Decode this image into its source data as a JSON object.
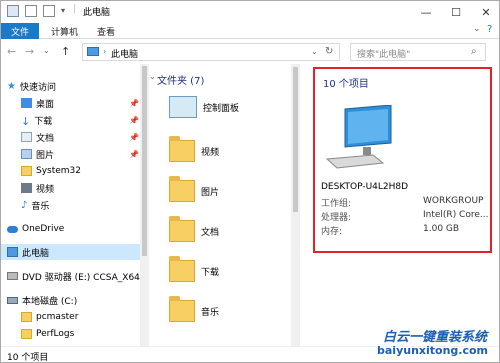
{
  "window": {
    "title": "此电脑"
  },
  "ribbon": {
    "tabs": [
      "文件",
      "计算机",
      "查看"
    ]
  },
  "nav": {
    "address": "此电脑",
    "search_placeholder": "搜索\"此电脑\"",
    "back": "←",
    "forward": "→",
    "up": "↑"
  },
  "sidebar": {
    "items": [
      {
        "label": "快速访问"
      },
      {
        "label": "桌面"
      },
      {
        "label": "下载"
      },
      {
        "label": "文档"
      },
      {
        "label": "图片"
      },
      {
        "label": "System32"
      },
      {
        "label": "视频"
      },
      {
        "label": "音乐"
      },
      {
        "label": "OneDrive"
      },
      {
        "label": "此电脑"
      },
      {
        "label": "DVD 驱动器 (E:) CCSA_X64"
      },
      {
        "label": "本地磁盘 (C:)"
      },
      {
        "label": "pcmaster"
      },
      {
        "label": "PerfLogs"
      }
    ]
  },
  "middle": {
    "group_header": "文件夹 (7)",
    "items": [
      "控制面板",
      "视频",
      "图片",
      "文档",
      "下载",
      "音乐"
    ]
  },
  "details": {
    "count": "10 个项目",
    "name": "DESKTOP-U4L2H8D",
    "rows": [
      {
        "label": "工作组:",
        "value": "WORKGROUP"
      },
      {
        "label": "处理器:",
        "value": "Intel(R) Core..."
      },
      {
        "label": "内存:",
        "value": "1.00 GB"
      }
    ]
  },
  "status": {
    "text": "10 个项目"
  },
  "watermark": {
    "line1": "白云一键重装系统",
    "line2": "baiyunxitong.com"
  }
}
